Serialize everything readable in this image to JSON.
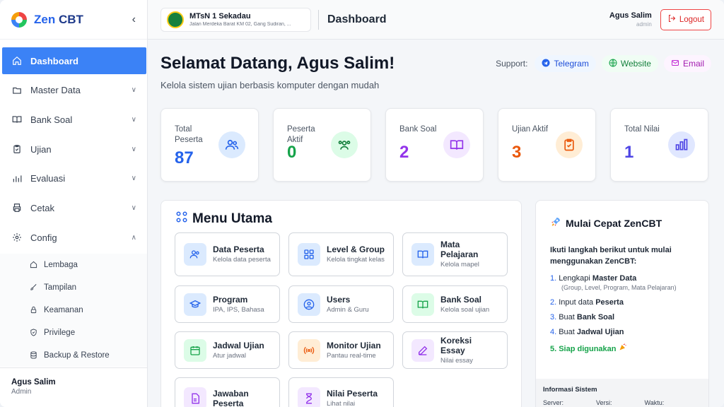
{
  "brand": {
    "name_a": "Zen",
    "name_b": " CBT"
  },
  "sidebar": {
    "items": [
      {
        "label": "Dashboard"
      },
      {
        "label": "Master Data"
      },
      {
        "label": "Bank Soal"
      },
      {
        "label": "Ujian"
      },
      {
        "label": "Evaluasi"
      },
      {
        "label": "Cetak"
      },
      {
        "label": "Config"
      }
    ],
    "config_sub": [
      {
        "label": "Lembaga"
      },
      {
        "label": "Tampilan"
      },
      {
        "label": "Keamanan"
      },
      {
        "label": "Privilege"
      },
      {
        "label": "Backup & Restore"
      }
    ],
    "user": {
      "name": "Agus Salim",
      "role": "Admin"
    }
  },
  "header": {
    "school_name": "MTsN 1 Sekadau",
    "school_address": "Jalan Merdeka Barat KM 02, Gang Sudiran, ...",
    "page_title": "Dashboard",
    "user_name": "Agus Salim",
    "user_role": "admin",
    "logout_label": "Logout"
  },
  "main": {
    "welcome": "Selamat Datang, Agus Salim!",
    "subtitle": "Kelola sistem ujian berbasis komputer dengan mudah",
    "support_label": "Support:",
    "support_links": [
      {
        "label": "Telegram"
      },
      {
        "label": "Website"
      },
      {
        "label": "Email"
      }
    ]
  },
  "stats": [
    {
      "label": "Total Peserta",
      "value": "87",
      "color": "#2563eb"
    },
    {
      "label": "Peserta Aktif",
      "value": "0",
      "color": "#16a34a"
    },
    {
      "label": "Bank Soal",
      "value": "2",
      "color": "#9333ea"
    },
    {
      "label": "Ujian Aktif",
      "value": "3",
      "color": "#ea580c"
    },
    {
      "label": "Total Nilai",
      "value": "1",
      "color": "#4f46e5"
    }
  ],
  "menu": {
    "title": "Menu Utama",
    "tiles": [
      {
        "title": "Data Peserta",
        "sub": "Kelola data peserta"
      },
      {
        "title": "Level & Group",
        "sub": "Kelola tingkat kelas"
      },
      {
        "title": "Mata Pelajaran",
        "sub": "Kelola mapel"
      },
      {
        "title": "Program",
        "sub": "IPA, IPS, Bahasa"
      },
      {
        "title": "Users",
        "sub": "Admin & Guru"
      },
      {
        "title": "Bank Soal",
        "sub": "Kelola soal ujian"
      },
      {
        "title": "Jadwal Ujian",
        "sub": "Atur jadwal"
      },
      {
        "title": "Monitor Ujian",
        "sub": "Pantau real-time"
      },
      {
        "title": "Koreksi Essay",
        "sub": "Nilai essay"
      },
      {
        "title": "Jawaban Peserta",
        "sub": ""
      },
      {
        "title": "Nilai Peserta",
        "sub": "Lihat nilai"
      }
    ]
  },
  "quickstart": {
    "title": "Mulai Cepat ZenCBT",
    "intro": "Ikuti langkah berikut untuk mulai menggunakan ZenCBT:",
    "steps": [
      {
        "num": "1.",
        "pre": "Lengkapi ",
        "bold": "Master Data",
        "hint": "(Group, Level, Program, Mata Pelajaran)"
      },
      {
        "num": "2.",
        "pre": "Input data ",
        "bold": "Peserta",
        "hint": ""
      },
      {
        "num": "3.",
        "pre": "Buat ",
        "bold": "Bank Soal",
        "hint": ""
      },
      {
        "num": "4.",
        "pre": "Buat ",
        "bold": "Jadwal Ujian",
        "hint": ""
      },
      {
        "num": "5.",
        "pre": "Siap digunakan",
        "bold": "",
        "hint": ""
      }
    ],
    "sysinfo_title": "Informasi Sistem",
    "sysinfo_cols": [
      "Server:",
      "Versi:",
      "Waktu:"
    ]
  }
}
